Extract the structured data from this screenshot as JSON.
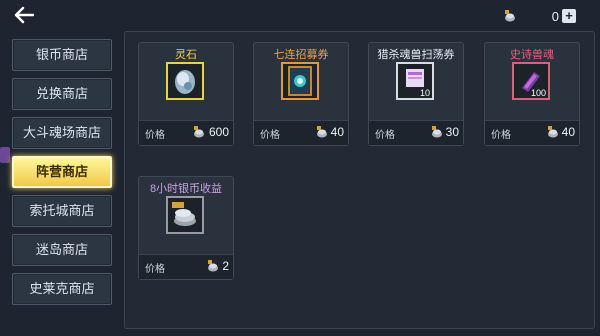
{
  "header": {
    "currency_amount": "0",
    "add_symbol": "+"
  },
  "sidebar": {
    "items": [
      {
        "label": "银币商店",
        "active": false
      },
      {
        "label": "兑换商店",
        "active": false
      },
      {
        "label": "大斗魂场商店",
        "active": false
      },
      {
        "label": "阵营商店",
        "active": true
      },
      {
        "label": "索托城商店",
        "active": false
      },
      {
        "label": "迷岛商店",
        "active": false
      },
      {
        "label": "史莱克商店",
        "active": false
      }
    ]
  },
  "shop": {
    "price_label": "价格",
    "items": [
      {
        "name": "灵石",
        "name_color": "#f3d24a",
        "frame_color": "#e8d24a",
        "price": "600",
        "quantity": ""
      },
      {
        "name": "七连招募券",
        "name_color": "#f0a14a",
        "frame_color": "#e09a3a",
        "price": "40",
        "quantity": ""
      },
      {
        "name": "猎杀魂兽扫荡券",
        "name_color": "#e6edf4",
        "frame_color": "#d8dde3",
        "price": "30",
        "quantity": "10"
      },
      {
        "name": "史诗兽魂",
        "name_color": "#e0607a",
        "frame_color": "#d7627a",
        "price": "40",
        "quantity": "100"
      },
      {
        "name": "8小时银币收益",
        "name_color": "#c9a0e0",
        "frame_color": "#9a9aa6",
        "price": "2",
        "quantity": ""
      }
    ]
  }
}
